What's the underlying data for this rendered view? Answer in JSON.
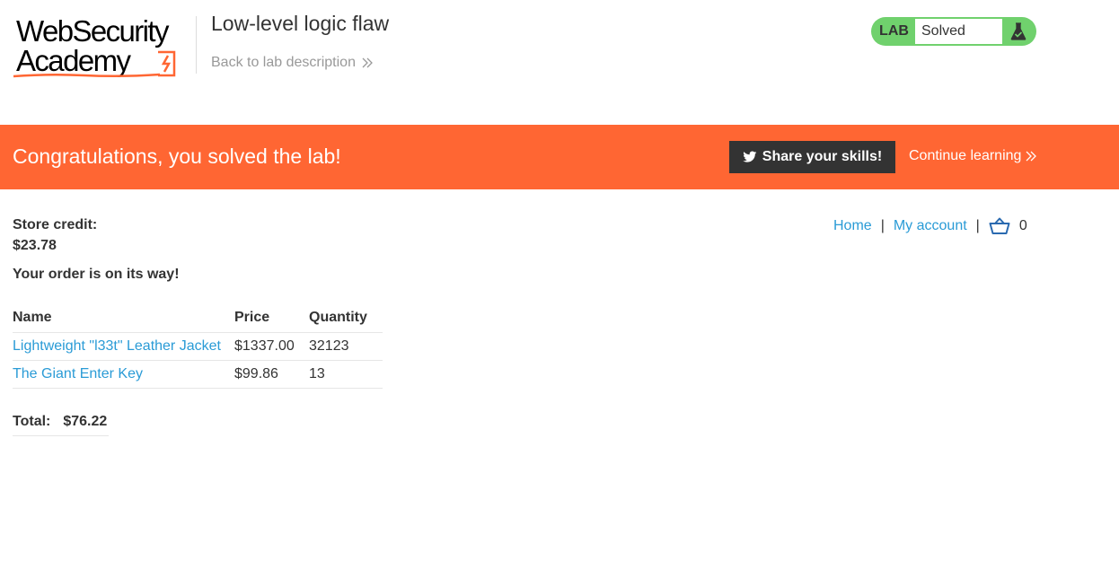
{
  "logo": {
    "line1": "WebSecurity",
    "line2": "Academy",
    "accent_color": "#ff6633"
  },
  "header": {
    "lab_title": "Low-level logic flaw",
    "back_link": "Back to lab description",
    "lab_badge": "LAB",
    "lab_status": "Solved",
    "status_color": "#70d16d",
    "status_icon": "flask-icon"
  },
  "banner": {
    "message": "Congratulations, you solved the lab!",
    "share_button": "Share your skills!",
    "share_icon": "twitter-icon",
    "continue_link": "Continue learning",
    "color": "#ff6633"
  },
  "account": {
    "store_credit_label": "Store credit:",
    "store_credit_value": "$23.78"
  },
  "nav": {
    "home": "Home",
    "separator": "|",
    "my_account": "My account",
    "cart_icon": "basket-icon",
    "cart_count": "0",
    "link_color": "#2a9bd6"
  },
  "order": {
    "message": "Your order is on its way!",
    "columns": [
      "Name",
      "Price",
      "Quantity"
    ],
    "rows": [
      {
        "name": "Lightweight \"l33t\" Leather Jacket",
        "price": "$1337.00",
        "quantity": "32123"
      },
      {
        "name": "The Giant Enter Key",
        "price": "$99.86",
        "quantity": "13"
      }
    ],
    "total_label": "Total:",
    "total_value": "$76.22"
  }
}
